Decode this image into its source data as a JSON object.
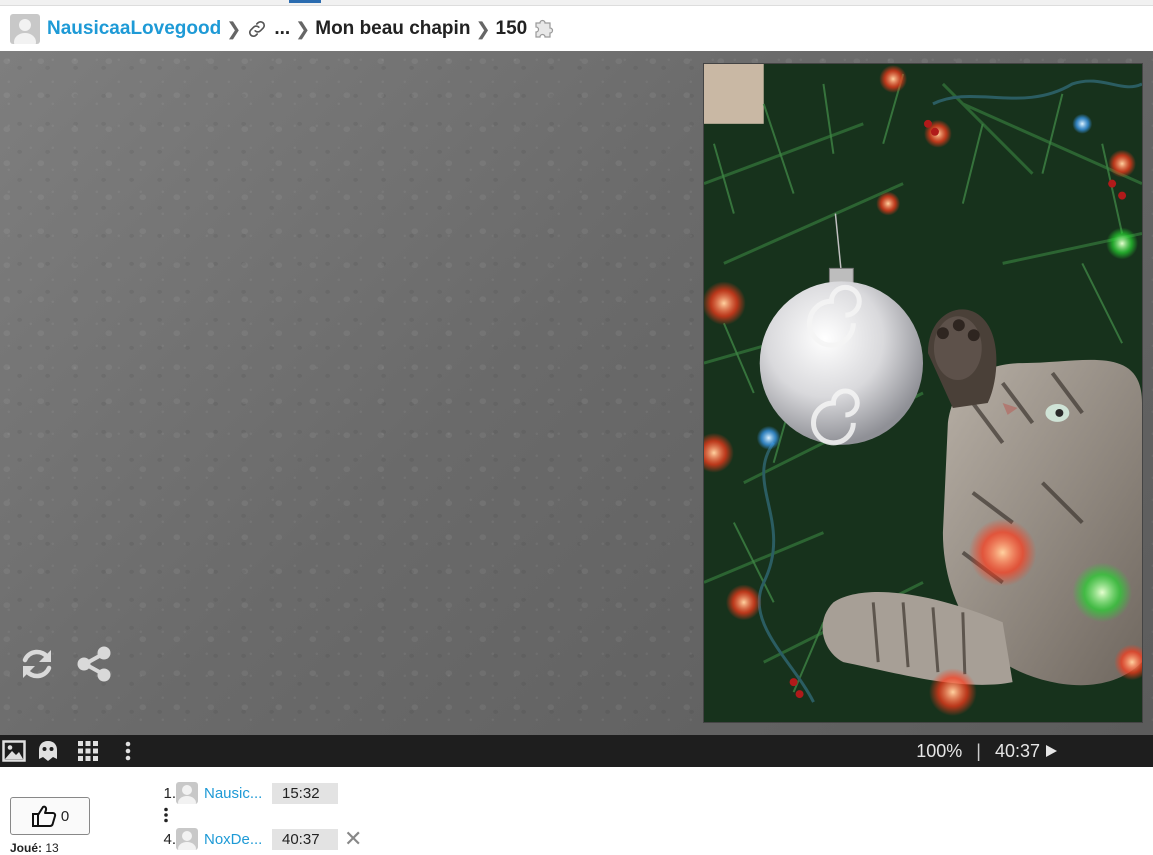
{
  "header": {
    "user": "NausicaaLovegood",
    "ellipsis": "...",
    "title": "Mon beau chapin",
    "pieces": "150"
  },
  "stage": {
    "icons": [
      "refresh-icon",
      "share-icon"
    ],
    "image_alt": "Cat playing with a silver ornament in a Christmas tree"
  },
  "toolbar": {
    "icons": [
      "image-icon",
      "ghost-icon",
      "grid-icon",
      "more-icon"
    ],
    "zoom": "100%",
    "separator": "|",
    "timer": "40:37"
  },
  "bottom": {
    "likes": "0",
    "played_label": "Joué:",
    "played_count": "13",
    "ranking": [
      {
        "rank": "1.",
        "name": "Nausic...",
        "time": "15:32"
      },
      {
        "rank": "4.",
        "name": "NoxDe...",
        "time": "40:37",
        "close": "✕"
      }
    ]
  },
  "colors": {
    "link": "#1e9ad6",
    "toolbar_bg": "#1e1e1e",
    "stage_bg": "#6e6e6e"
  }
}
